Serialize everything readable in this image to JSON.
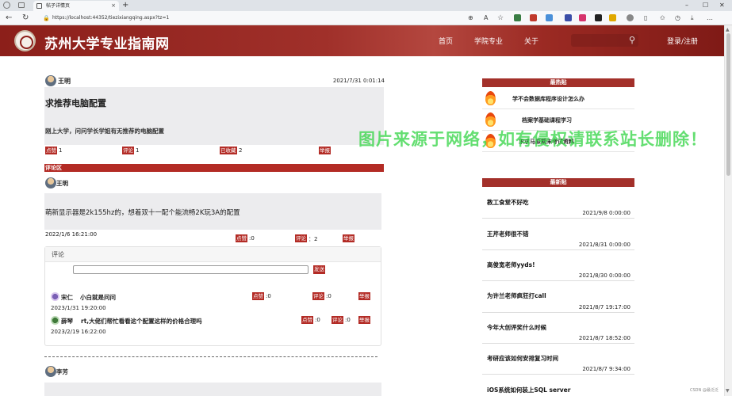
{
  "browser": {
    "tab_title": "帖子详情页",
    "close_tab": "×",
    "new_tab": "+",
    "url": "https://localhost:44352/tiezixiangqing.aspx?tz=1",
    "minimize": "–",
    "maximize": "☐",
    "close": "✕"
  },
  "site": {
    "name": "苏州大学专业指南网",
    "nav": [
      "首页",
      "学院专业",
      "关于"
    ],
    "search_placeholder": "",
    "login": "登录/注册"
  },
  "post": {
    "author": "王明",
    "time": "2021/7/31 0:01:14",
    "title": "求推荐电脑配置",
    "body": "刚上大学，问问学长学姐有无推荐的电脑配置",
    "like_label": "点赞",
    "like_count": "1",
    "comment_label": "评论",
    "comment_count": "1",
    "fav_label": "已收藏",
    "fav_count": "2",
    "report_label": "举报"
  },
  "comment_section": {
    "header": "评论区",
    "replies": [
      {
        "author": "王明",
        "body": "萌新显示器是2k155hz的，想着双十一配个能流畅2K玩3A的配置",
        "time": "2022/1/6 16:21:00",
        "like_label": "点赞",
        "like_count": ":0",
        "comment_label": "评论",
        "comment_count": "：2",
        "report_label": "举报"
      },
      {
        "author": "李芳"
      }
    ],
    "panel": {
      "title": "评论",
      "send_label": "发送",
      "items": [
        {
          "author": "宋仁",
          "text": "小白就是问问",
          "time": "2023/1/31 19:20:00",
          "like_label": "点赞",
          "like_count": ":0",
          "comment_label": "评论",
          "comment_count": ":0",
          "report_label": "举报"
        },
        {
          "author": "薛琴",
          "text": "rt,大佬们帮忙看看这个配置这样的价格合理吗",
          "time": "2023/2/19 16:22:00",
          "like_label": "点赞",
          "like_count": ":0",
          "comment_label": "评论",
          "comment_count": ":0",
          "report_label": "举报"
        }
      ]
    }
  },
  "sidebar": {
    "hot_title": "最热贴",
    "hot": [
      "学不会数据库程序设计怎么办",
      "档案学基础课程学习",
      "求求马原期末考试资料"
    ],
    "new_title": "最新贴",
    "new": [
      {
        "title": "教工食堂不好吃",
        "date": "2021/9/8 0:00:00"
      },
      {
        "title": "王芹老师很不错",
        "date": "2021/8/31 0:00:00"
      },
      {
        "title": "高俊宽老师yyds!",
        "date": "2021/8/30 0:00:00"
      },
      {
        "title": "为许兰老师疯狂打call",
        "date": "2021/8/7 19:17:00"
      },
      {
        "title": "今年大创评奖什么时候",
        "date": "2021/8/7 18:52:00"
      },
      {
        "title": "考研应该如何安排复习时间",
        "date": "2021/8/7 9:34:00"
      },
      {
        "title": "iOS系统如何装上SQL server",
        "date": ""
      }
    ]
  },
  "watermark": "图片来源于网络，如有侵权请联系站长删除！",
  "csdn_mark": "CSDN @最泛泛",
  "colors": {
    "accent": "#b32b25",
    "header": "#9b2a23",
    "watermark": "#39d64a"
  }
}
